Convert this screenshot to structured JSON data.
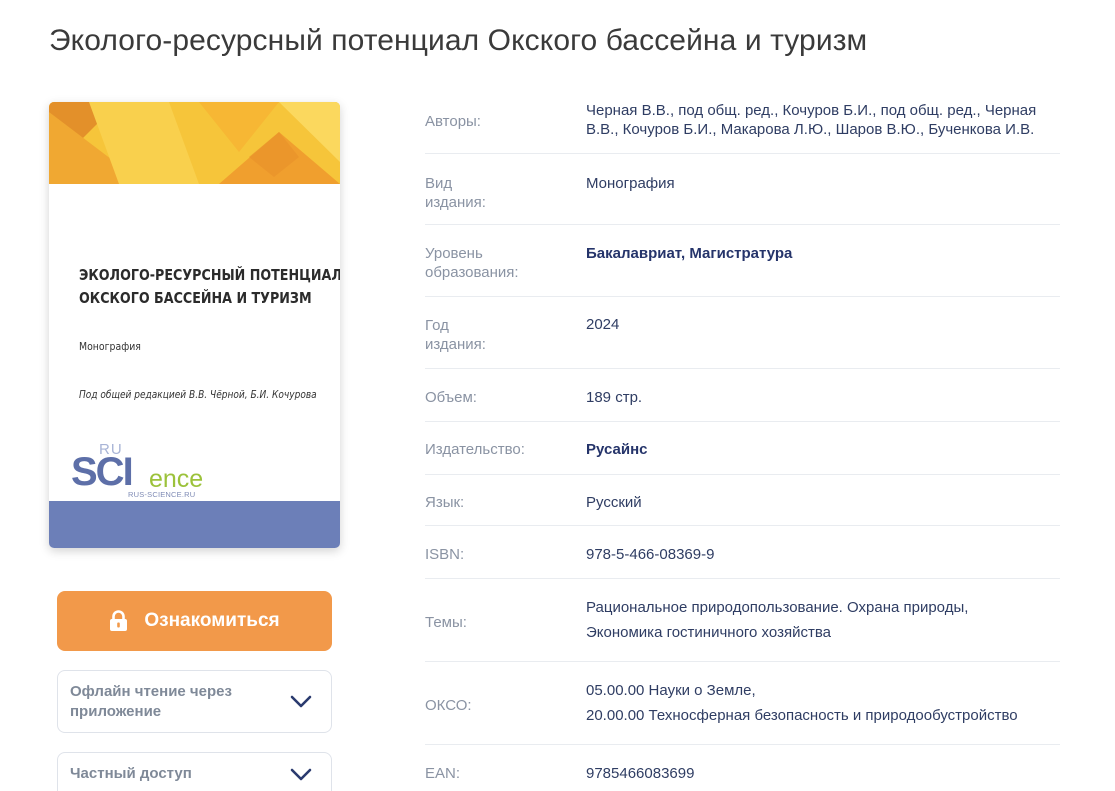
{
  "page": {
    "title": "Эколого-ресурсный потенциал Окского бассейна и туризм"
  },
  "cover": {
    "title_line1": "ЭКОЛОГО-РЕСУРСНЫЙ ПОТЕНЦИАЛ",
    "title_line2": "ОКСКОГО БАССЕЙНА И ТУРИЗМ",
    "type": "Монография",
    "editors": "Под общей редакцией В.В. Чёрной, Б.И.  Кочурова",
    "logo_ru": "RU",
    "logo_sci": "SCI",
    "logo_ence": "ence",
    "logo_url": "RUS-SCIENCE.RU",
    "colors": {
      "top_band": "#f4b92f",
      "bottom_band": "#6c7fb8"
    }
  },
  "actions": {
    "read_label": "Ознакомиться",
    "read_icon": "lock-icon",
    "offline_label": "Офлайн чтение через приложение",
    "private_label": "Частный доступ",
    "accordion_icon": "chevron-down-icon",
    "accent_color": "#f2994a"
  },
  "details": {
    "authors": {
      "label": "Авторы:",
      "value": "Черная В.В., под общ. ред., Кочуров Б.И., под общ. ред., Черная В.В., Кочуров Б.И., Макарова Л.Ю., Шаров В.Ю., Бученкова И.В."
    },
    "kind": {
      "label": "Вид издания:",
      "value": "Монография"
    },
    "level": {
      "label": "Уровень образования:",
      "value": "Бакалавриат, Магистратура"
    },
    "year": {
      "label": "Год издания:",
      "value": "2024"
    },
    "volume": {
      "label": "Объем:",
      "value": "189 стр."
    },
    "publisher": {
      "label": "Издательство:",
      "value": "Русайнс"
    },
    "language": {
      "label": "Язык:",
      "value": "Русский"
    },
    "isbn": {
      "label": "ISBN:",
      "value": "978-5-466-08369-9"
    },
    "topics": {
      "label": "Темы:",
      "items": [
        "Рациональное природопользование. Охрана природы,",
        "Экономика гостиничного хозяйства"
      ]
    },
    "okso": {
      "label": "ОКСО:",
      "items": [
        "05.00.00 Науки о Земле,",
        "20.00.00 Техносферная безопасность и природообустройство"
      ]
    },
    "ean": {
      "label": "EAN:",
      "value": "9785466083699"
    }
  }
}
